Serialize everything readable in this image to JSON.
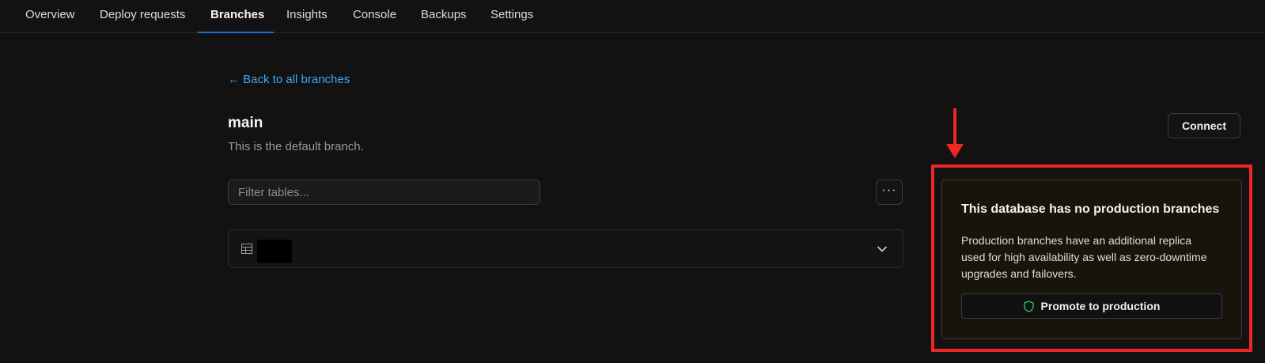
{
  "nav": {
    "tabs": [
      {
        "label": "Overview"
      },
      {
        "label": "Deploy requests"
      },
      {
        "label": "Branches",
        "active": true
      },
      {
        "label": "Insights"
      },
      {
        "label": "Console"
      },
      {
        "label": "Backups"
      },
      {
        "label": "Settings"
      }
    ]
  },
  "branch": {
    "back_link": "← Back to all branches",
    "name": "main",
    "description": "This is the default branch."
  },
  "toolbar": {
    "connect_label": "Connect",
    "filter_placeholder": "Filter tables...",
    "more_label": "···"
  },
  "tables": [
    {
      "name": "[redacted]",
      "icon": "table-icon",
      "expand_icon": "chevron-down-icon"
    }
  ],
  "production_card": {
    "title": "This database has no production branches",
    "description": "Production branches have an additional replica used for high availability as well as zero-downtime upgrades and failovers.",
    "button_label": "Promote to production",
    "button_icon": "shield-icon"
  },
  "colors": {
    "accent_link": "#3ea6f5",
    "active_tab_underline": "#1d6fd6",
    "annotation_red": "#ee2626",
    "shield_green": "#2fbf5a"
  }
}
